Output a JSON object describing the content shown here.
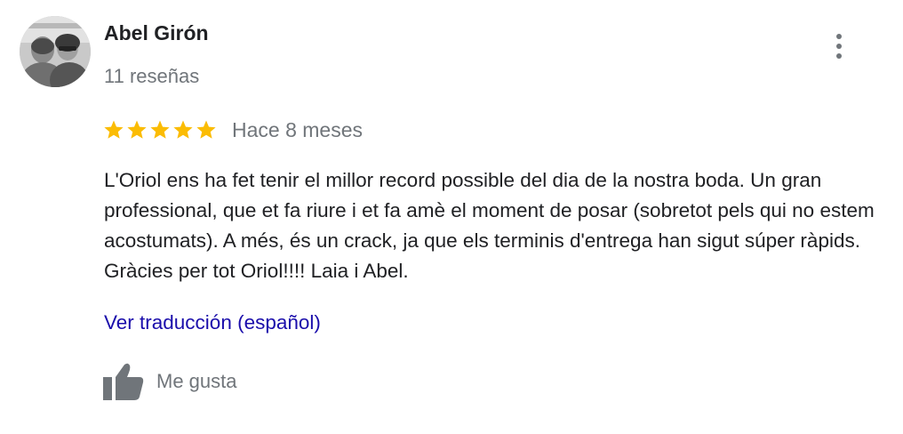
{
  "review": {
    "author_name": "Abel Girón",
    "review_count": "11 reseñas",
    "rating": 5,
    "rating_max": 5,
    "date": "Hace 8 meses",
    "text": "L'Oriol ens ha fet tenir el millor record possible del dia de la nostra boda. Un gran professional, que et fa riure i et fa amè el moment de posar (sobretot pels qui no estem acostumats). A més, és un crack, ja que els terminis d'entrega han sigut súper ràpids. Gràcies per tot Oriol!!!! Laia i Abel.",
    "translate_link": "Ver traducción (español)",
    "like_label": "Me gusta"
  },
  "icons": {
    "more": "more-vert-icon",
    "star": "star-icon",
    "like": "thumb-up-icon"
  },
  "colors": {
    "star": "#fbbc04",
    "link": "#1a0dab",
    "secondary_text": "#70757a",
    "primary_text": "#202124"
  }
}
